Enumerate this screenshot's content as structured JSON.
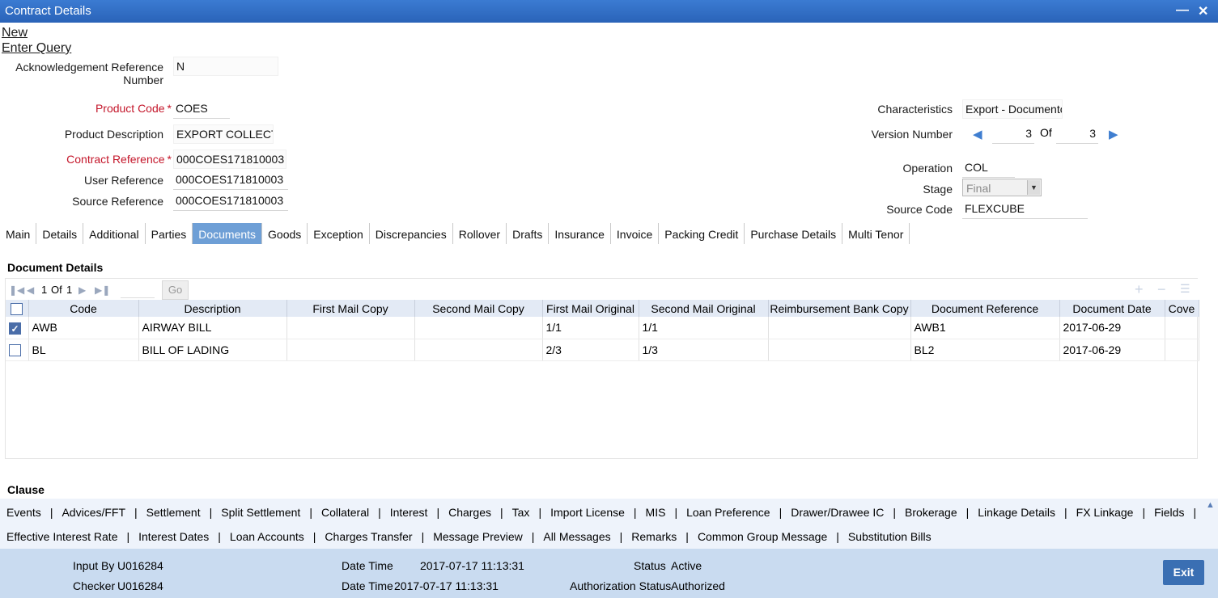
{
  "window": {
    "title": "Contract Details"
  },
  "menu": {
    "new": "New",
    "enter_query": "Enter Query"
  },
  "fields": {
    "ack_ref_label_1": "Acknowledgement Reference",
    "ack_ref_label_2": "Number",
    "ack_ref_value": "N",
    "product_code_label": "Product Code",
    "product_code_value": "COES",
    "product_desc_label": "Product Description",
    "product_desc_value": "EXPORT COLLECTIO",
    "contract_ref_label": "Contract Reference",
    "contract_ref_value": "000COES171810003",
    "user_ref_label": "User Reference",
    "user_ref_value": "000COES171810003",
    "source_ref_label": "Source Reference",
    "source_ref_value": "000COES171810003",
    "required_marker": "*"
  },
  "right_fields": {
    "characteristics_label": "Characteristics",
    "characteristics_value": "Export  - Documento",
    "version_label": "Version Number",
    "version_current": "3",
    "version_of": "Of",
    "version_total": "3",
    "operation_label": "Operation",
    "operation_value": "COL",
    "stage_label": "Stage",
    "stage_value": "Final",
    "source_code_label": "Source Code",
    "source_code_value": "FLEXCUBE"
  },
  "tabs": [
    "Main",
    "Details",
    "Additional",
    "Parties",
    "Documents",
    "Goods",
    "Exception",
    "Discrepancies",
    "Rollover",
    "Drafts",
    "Insurance",
    "Invoice",
    "Packing Credit",
    "Purchase Details",
    "Multi Tenor"
  ],
  "active_tab": "Documents",
  "documents": {
    "section_title": "Document Details",
    "pager": {
      "current": "1",
      "of": "Of",
      "total": "1",
      "go": "Go"
    },
    "columns": [
      "Code",
      "Description",
      "First Mail Copy",
      "Second Mail Copy",
      "First Mail Original",
      "Second Mail Original",
      "Reimbursement Bank Copy",
      "Document Reference",
      "Document Date",
      "Cove"
    ],
    "rows": [
      {
        "checked": true,
        "code": "AWB",
        "description": "AIRWAY BILL",
        "first_mail_copy": "",
        "second_mail_copy": "",
        "first_mail_original": "1/1",
        "second_mail_original": "1/1",
        "reimb_bank_copy": "",
        "doc_ref": "AWB1",
        "doc_date": "2017-06-29",
        "cover": ""
      },
      {
        "checked": false,
        "code": "BL",
        "description": "BILL OF LADING",
        "first_mail_copy": "",
        "second_mail_copy": "",
        "first_mail_original": "2/3",
        "second_mail_original": "1/3",
        "reimb_bank_copy": "",
        "doc_ref": "BL2",
        "doc_date": "2017-06-29",
        "cover": ""
      }
    ]
  },
  "clause": {
    "title": "Clause"
  },
  "links_row1": [
    "Events",
    "Advices/FFT",
    "Settlement",
    "Split Settlement",
    "Collateral",
    "Interest",
    "Charges",
    "Tax",
    "Import License",
    "MIS",
    "Loan Preference",
    "Drawer/Drawee IC",
    "Brokerage",
    "Linkage Details",
    "FX Linkage",
    "Fields"
  ],
  "links_row2": [
    "Effective Interest Rate",
    "Interest Dates",
    "Loan Accounts",
    "Charges Transfer",
    "Message Preview",
    "All Messages",
    "Remarks",
    "Common Group Message",
    "Substitution Bills"
  ],
  "link_separator": "|",
  "footer": {
    "input_by_label": "Input By",
    "input_by_value": "U016284",
    "checker_label": "Checker",
    "checker_value": "U016284",
    "date_time_label": "Date Time",
    "date_time_1": "2017-07-17 11:13:31",
    "date_time_2": "2017-07-17 11:13:31",
    "status_label": "Status",
    "status_value": "Active",
    "auth_status_label": "Authorization Status",
    "auth_status_value": "Authorized",
    "exit_label": "Exit"
  }
}
